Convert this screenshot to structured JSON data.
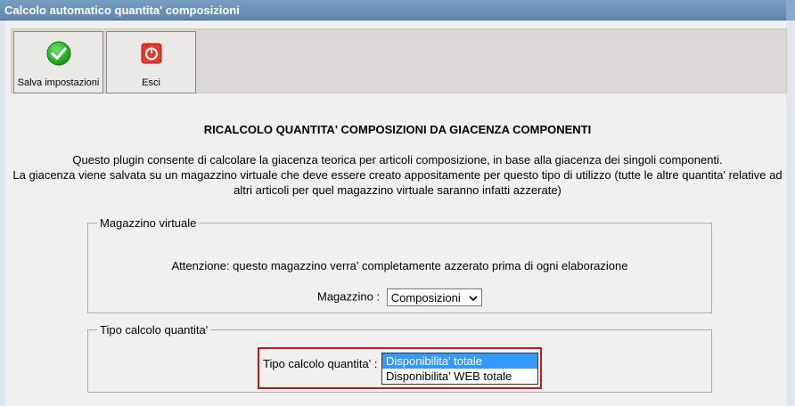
{
  "window": {
    "title": "Calcolo automatico quantita' composizioni"
  },
  "toolbar": {
    "save_label": "Salva impostazioni",
    "exit_label": "Esci"
  },
  "content": {
    "heading": "RICALCOLO QUANTITA' COMPOSIZIONI DA GIACENZA COMPONENTI",
    "desc_line1": "Questo plugin consente di calcolare la giacenza teorica per articoli composizione, in base alla giacenza dei singoli componenti.",
    "desc_line2": "La giacenza viene salvata su un magazzino virtuale che deve essere creato appositamente per questo tipo di utilizzo (tutte le altre quantita' relative ad",
    "desc_line3": "altri articoli per quel magazzino virtuale saranno infatti azzerate)"
  },
  "magazzino": {
    "legend": "Magazzino virtuale",
    "warning": "Attenzione: questo magazzino verra' completamente azzerato prima di ogni elaborazione",
    "label": "Magazzino :",
    "selected": "Composizioni"
  },
  "tipo": {
    "legend": "Tipo calcolo quantita'",
    "label": "Tipo calcolo quantita' :",
    "options": [
      "Disponibilita' totale",
      "Disponibilita' WEB totale"
    ],
    "highlight_color": "#3399ff",
    "frame_color": "#c81818"
  }
}
